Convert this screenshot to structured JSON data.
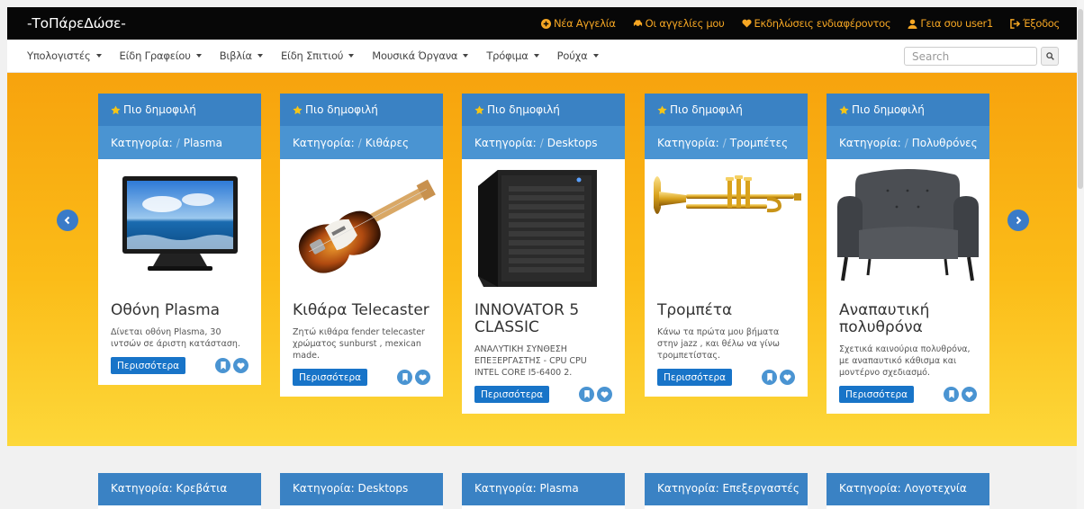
{
  "navbar": {
    "brand": "-ΤοΠάρεΔώσε-",
    "links": [
      {
        "label": "Νέα Αγγελία",
        "icon": "plus-circle-icon"
      },
      {
        "label": "Οι αγγελίες μου",
        "icon": "car-icon"
      },
      {
        "label": "Εκδηλώσεις ενδιαφέροντος",
        "icon": "heart-icon"
      },
      {
        "label": "Γεια σου user1",
        "icon": "user-icon"
      },
      {
        "label": "Έξοδος",
        "icon": "logout-icon"
      }
    ]
  },
  "categories": [
    "Υπολογιστές",
    "Είδη Γραφείου",
    "Βιβλία",
    "Είδη Σπιτιού",
    "Μουσικά Όργανα",
    "Τρόφιμα",
    "Ρούχα"
  ],
  "search": {
    "placeholder": "Search"
  },
  "featured": {
    "popular_label": "Πιο δημοφιλή",
    "category_prefix": "Κατηγορία:",
    "separator": "/",
    "more_label": "Περισσότερα",
    "items": [
      {
        "category": "Plasma",
        "title": "Οθόνη Plasma",
        "desc": "Δίνεται οθόνη Plasma, 30 ιντσών σε άριστη κατάσταση.",
        "image": "plasma-tv-image"
      },
      {
        "category": "Κιθάρες",
        "title": "Κιθάρα Telecaster",
        "desc": "Ζητώ κιθάρα fender telecaster χρώματος sunburst , mexican made.",
        "image": "guitar-image"
      },
      {
        "category": "Desktops",
        "title": "INNOVATOR 5 CLASSIC",
        "desc": "ΑΝΑΛΥΤΙΚΗ ΣΥΝΘΕΣΗ ΕΠΕΞΕΡΓΑΣΤΗΣ - CPU CPU INTEL CORE I5-6400 2.",
        "image": "desktop-tower-image"
      },
      {
        "category": "Τρομπέτες",
        "title": "Τρομπέτα",
        "desc": "Κάνω τα πρώτα μου βήματα στην jazz , και θέλω να γίνω τρομπετίστας.",
        "image": "trumpet-image"
      },
      {
        "category": "Πολυθρόνες",
        "title": "Αναπαυτική πολυθρόνα",
        "desc": "Σχετικά καινούρια πολυθρόνα, με αναπαυτικό κάθισμα και μοντέρνο σχεδιασμό.",
        "image": "armchair-image"
      }
    ]
  },
  "lower": {
    "items": [
      {
        "label": "Κατηγορία: Κρεβάτια"
      },
      {
        "label": "Κατηγορία: Desktops"
      },
      {
        "label": "Κατηγορία: Plasma"
      },
      {
        "label": "Κατηγορία: Επεξεργαστές"
      },
      {
        "label": "Κατηγορία: Λογοτεχνία"
      }
    ]
  },
  "colors": {
    "navbar": "#070707",
    "link": "#f5a623",
    "header_blue": "#3a82c4",
    "button_blue": "#1874c8",
    "hero_top": "#f7a30d",
    "hero_bottom": "#fdd83a"
  }
}
